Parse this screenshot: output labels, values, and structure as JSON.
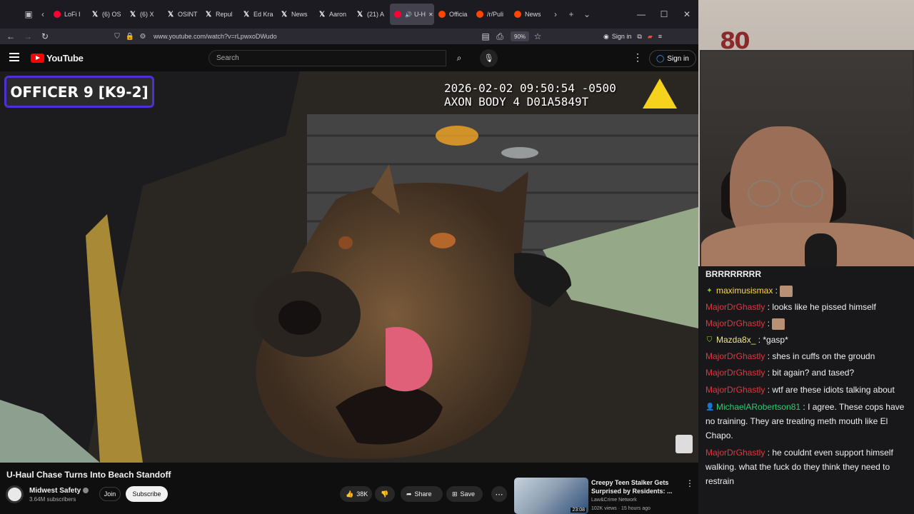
{
  "browser": {
    "tabs": [
      {
        "label": "LoFi I",
        "favicon": "red"
      },
      {
        "label": "(6) OS",
        "favicon": "x"
      },
      {
        "label": "(6) X",
        "favicon": "x"
      },
      {
        "label": "OSINT",
        "favicon": "x"
      },
      {
        "label": "Repul",
        "favicon": "x"
      },
      {
        "label": "Ed Kra",
        "favicon": "x"
      },
      {
        "label": "News",
        "favicon": "x"
      },
      {
        "label": "Aaron",
        "favicon": "x"
      },
      {
        "label": "(21) A",
        "favicon": "x"
      },
      {
        "label": "U-H",
        "favicon": "red",
        "active": true
      },
      {
        "label": "Officia",
        "favicon": "reddit"
      },
      {
        "label": "/r/Puli",
        "favicon": "reddit"
      },
      {
        "label": "News",
        "favicon": "reddit"
      }
    ],
    "url": "www.youtube.com/watch?v=rLpwxoDWudo",
    "zoom": "90%",
    "signin": "Sign in"
  },
  "youtube": {
    "logo": "YouTube",
    "search_placeholder": "Search",
    "signin": "Sign in"
  },
  "video": {
    "officer_tag": "OFFICER 9 [K9-2]",
    "timestamp": "2026-02-02 09:50:54 -0500",
    "device": "AXON BODY 4 D01A5849T"
  },
  "meta": {
    "title": "U-Haul Chase Turns Into Beach Standoff",
    "channel": "Midwest Safety",
    "subscribers": "3.64M subscribers",
    "join": "Join",
    "subscribe": "Subscribe",
    "likes": "38K",
    "share": "Share",
    "save": "Save"
  },
  "recommendation": {
    "title": "Creepy Teen Stalker Gets Surprised by Residents: ...",
    "channel": "Law&Crime Network",
    "meta": "102K views · 15 hours ago",
    "duration": "23:08"
  },
  "webcam": {
    "sign": "80"
  },
  "chat": [
    {
      "user": "",
      "color": "#efeff1",
      "text": "BRRRRRRRR",
      "emote": false,
      "badge": ""
    },
    {
      "user": "maximusismax",
      "color": "#ffd84a",
      "text": "",
      "emote": true,
      "badge": "✦",
      "badge_color": "#7ed321"
    },
    {
      "user": "MajorDrGhastly",
      "color": "#e0373f",
      "text": "looks like he pissed himself",
      "emote": false,
      "badge": ""
    },
    {
      "user": "MajorDrGhastly",
      "color": "#e0373f",
      "text": "",
      "emote": true,
      "badge": ""
    },
    {
      "user": "Mazda8x_",
      "color": "#f0e68c",
      "text": "*gasp*",
      "emote": false,
      "badge": "⛉",
      "badge_color": "#9acd32"
    },
    {
      "user": "MajorDrGhastly",
      "color": "#e0373f",
      "text": "shes in cuffs on the groudn",
      "emote": false,
      "badge": ""
    },
    {
      "user": "MajorDrGhastly",
      "color": "#e0373f",
      "text": "bit again? and tased?",
      "emote": false,
      "badge": ""
    },
    {
      "user": "MajorDrGhastly",
      "color": "#e0373f",
      "text": "wtf are these idiots talking about",
      "emote": false,
      "badge": ""
    },
    {
      "user": "MichaelARobertson81",
      "color": "#2ecc71",
      "text": "I agree. These cops have no training. They are treating meth mouth like El Chapo.",
      "emote": false,
      "badge": "👤",
      "badge_color": "#4a90e2"
    },
    {
      "user": "MajorDrGhastly",
      "color": "#e0373f",
      "text": "he couldnt even support himself walking. what the fuck do they think they need to restrain",
      "emote": false,
      "badge": ""
    }
  ]
}
